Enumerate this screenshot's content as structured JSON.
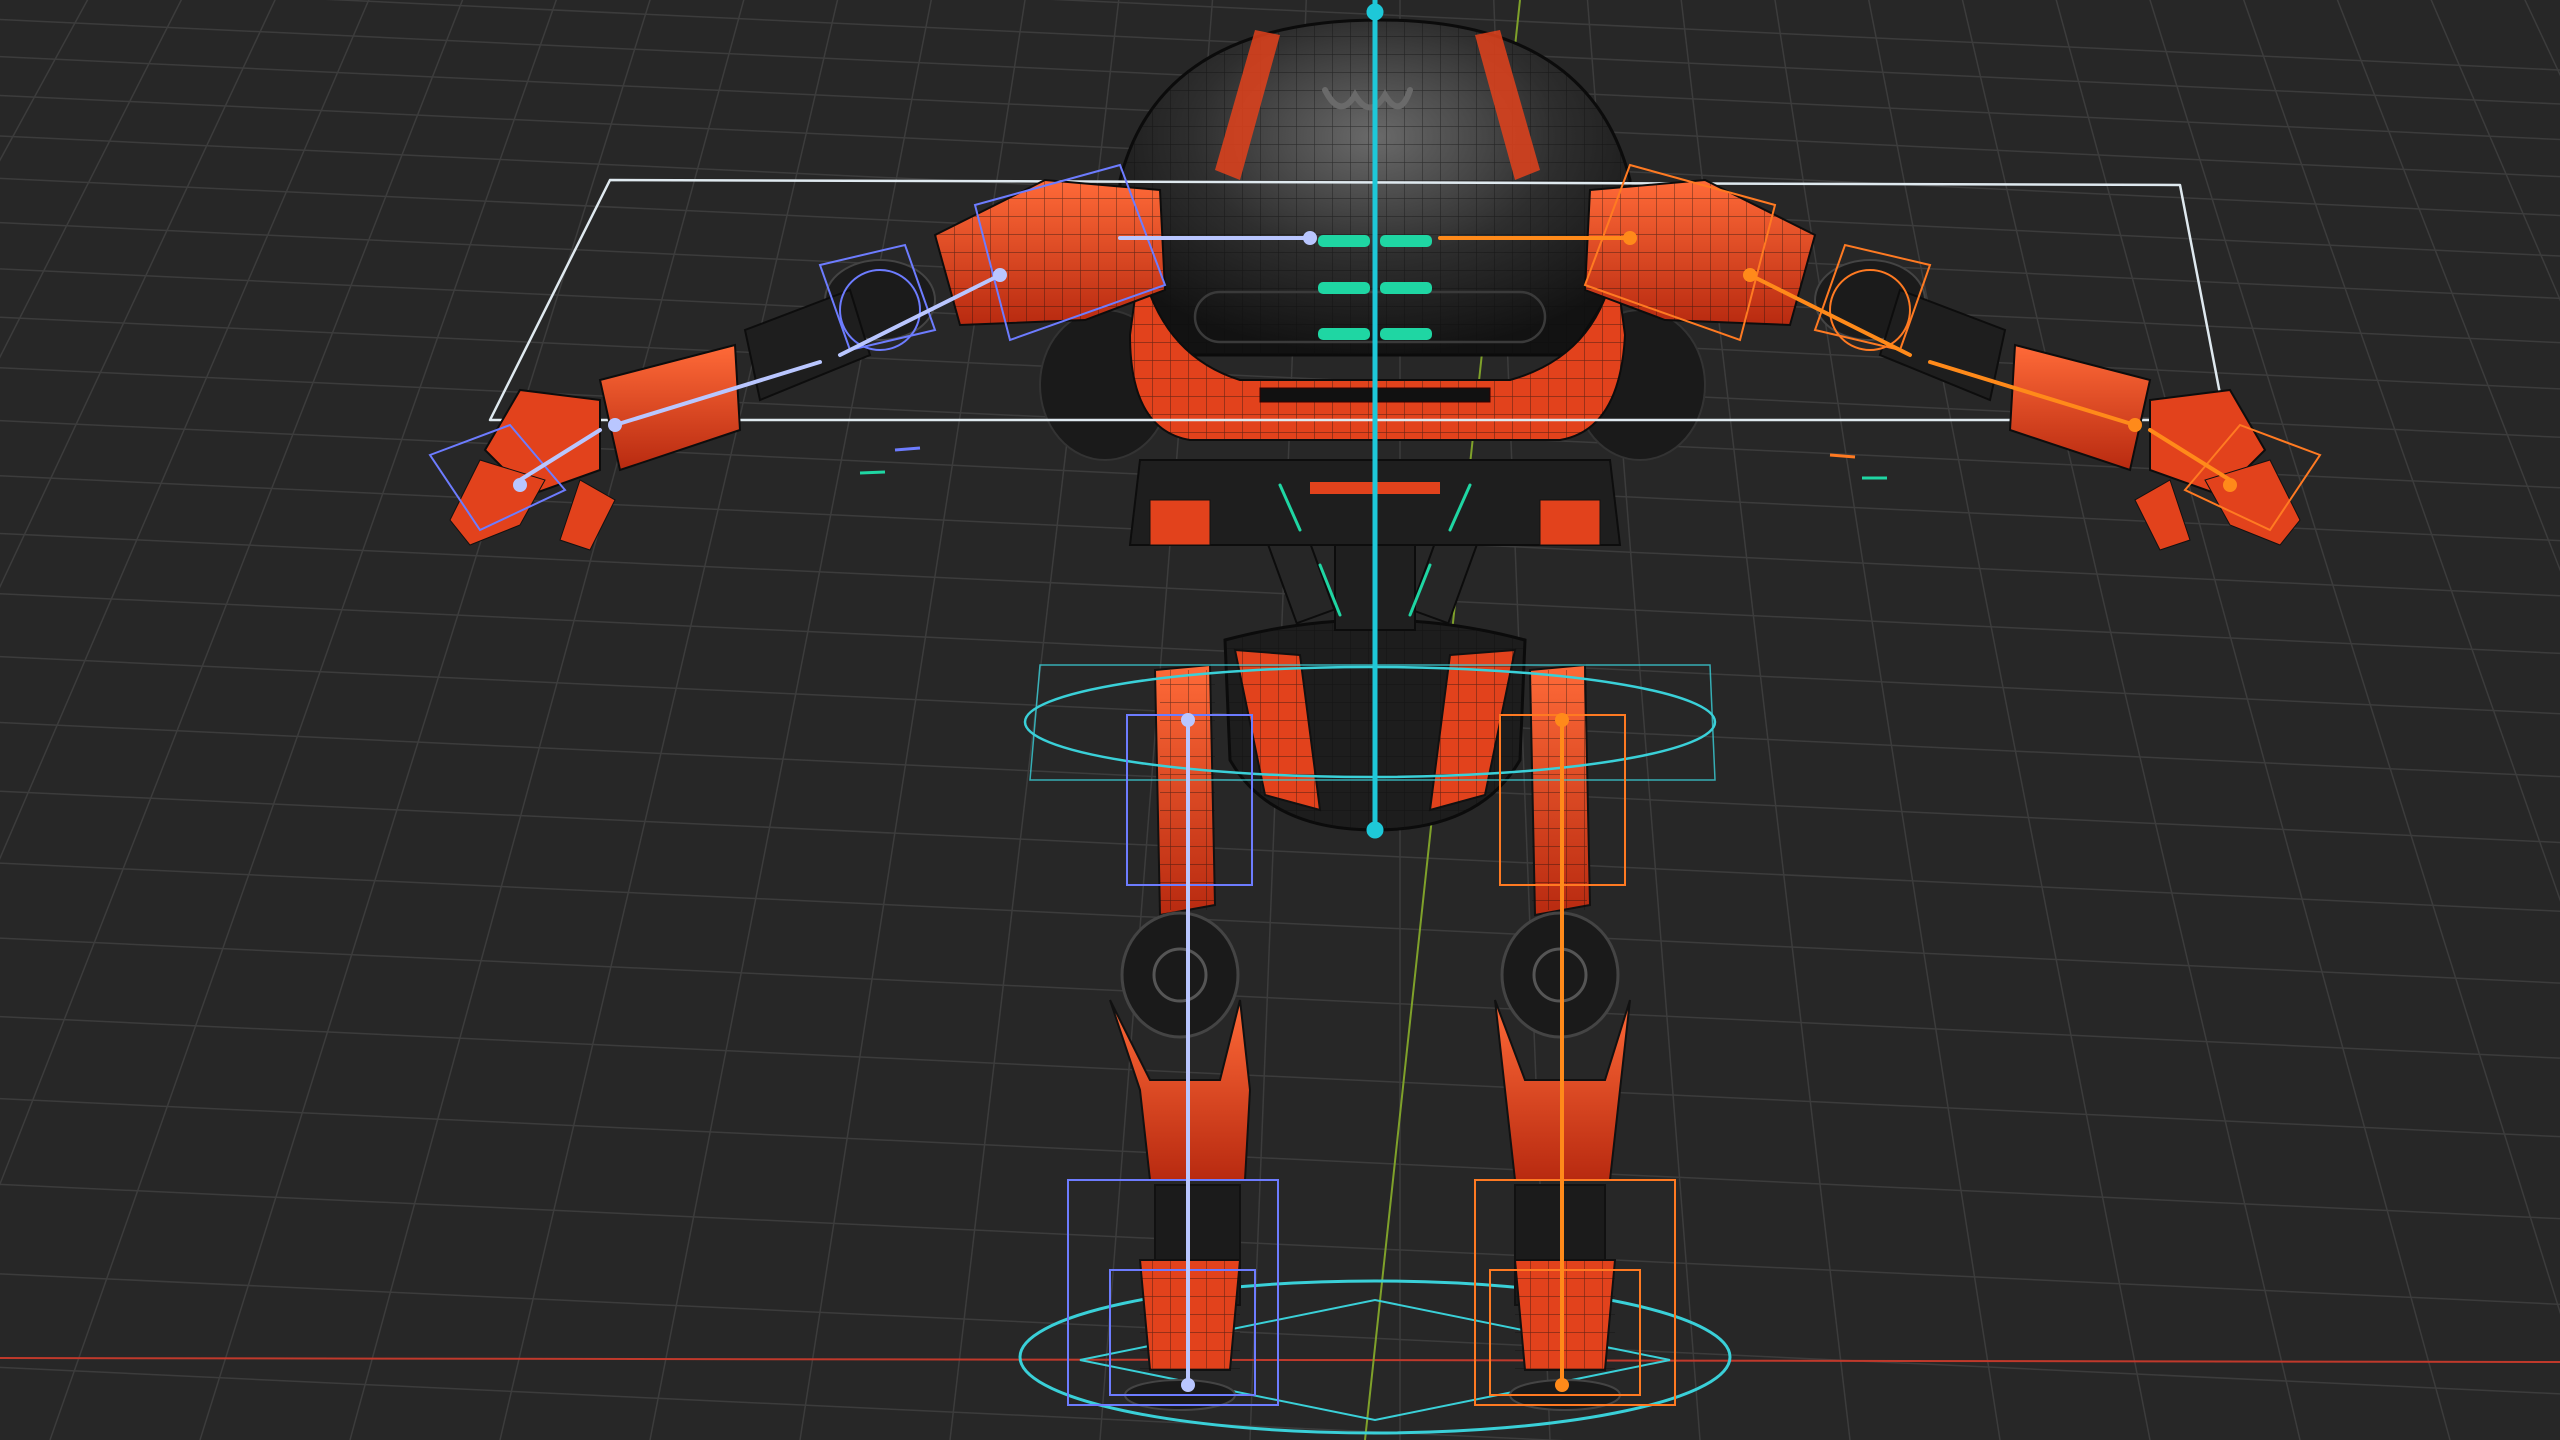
{
  "viewport": {
    "view_mode": "perspective-wireframe-overlay",
    "background_color": "#272727",
    "grid_color": "#3c3c3c",
    "axis_x_color": "#c0392b",
    "axis_y_color": "#7fa12a"
  },
  "scene": {
    "object": "robot-rig",
    "mesh_color": "#e2421c",
    "mesh_dark_color": "#1c1c1c",
    "wire_color": "#0d0d0d",
    "bone_center_color": "#1ec8d8",
    "bone_left_color": "#b9c6ff",
    "bone_right_color": "#ff8a1a",
    "control_center_color": "#3ad0d8",
    "control_left_color": "#6d7cff",
    "control_right_color": "#ff7a22",
    "control_root_color": "#dfe9ef",
    "control_green_color": "#1fd6a3",
    "icons": [
      "armature-icon",
      "control-shape-icon"
    ]
  }
}
